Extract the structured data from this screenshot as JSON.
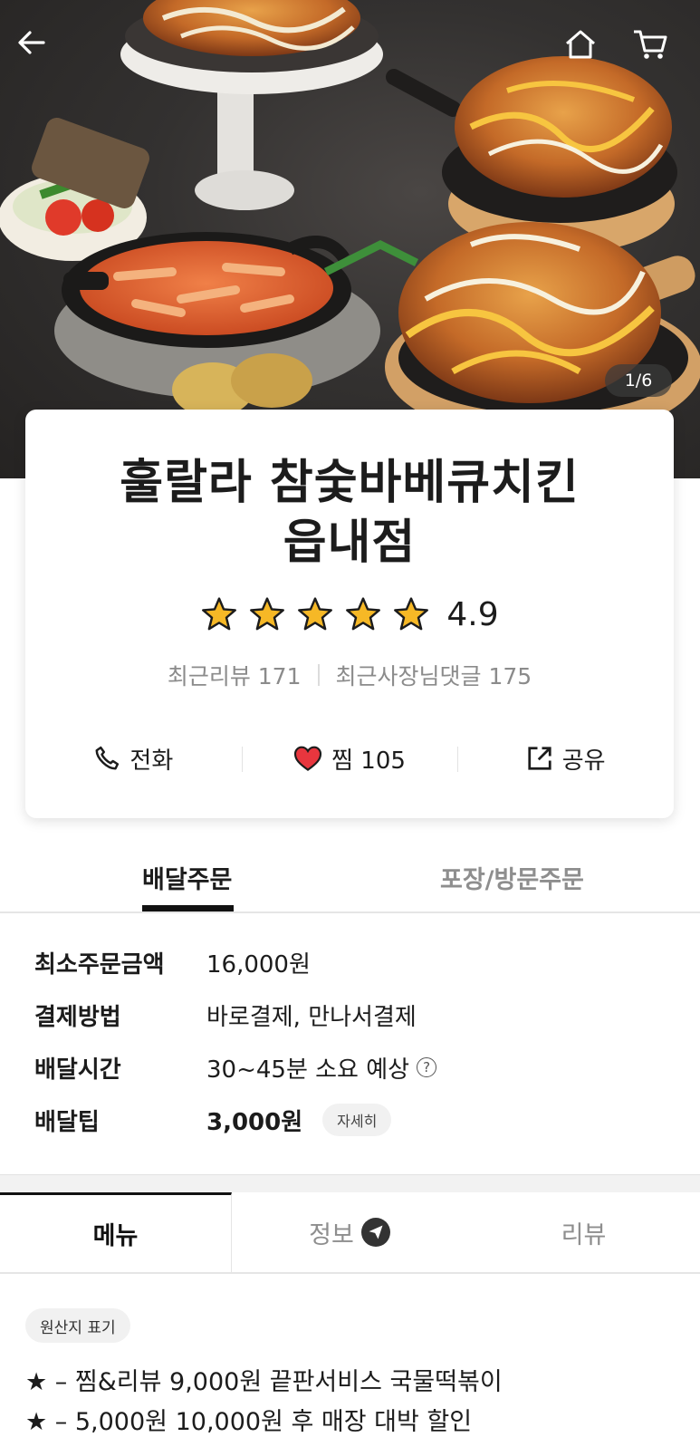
{
  "header": {
    "back_icon": "arrow-left-icon",
    "home_icon": "home-icon",
    "cart_icon": "cart-icon",
    "image_counter": "1/6"
  },
  "store": {
    "name_line1": "훌랄라 참숯바베큐치킨",
    "name_line2": "읍내점",
    "rating": "4.9",
    "star_count": 5,
    "recent_reviews_label": "최근리뷰 171",
    "recent_owner_replies_label": "최근사장님댓글 175",
    "actions": {
      "call_label": "전화",
      "like_label": "찜 105",
      "share_label": "공유"
    }
  },
  "order_tabs": {
    "delivery": "배달주문",
    "pickup": "포장/방문주문",
    "active": "delivery"
  },
  "delivery_info": {
    "min_order_label": "최소주문금액",
    "min_order_value": "16,000원",
    "payment_label": "결제방법",
    "payment_value": "바로결제, 만나서결제",
    "time_label": "배달시간",
    "time_value": "30~45분 소요 예상",
    "tip_label": "배달팁",
    "tip_value": "3,000원",
    "tip_detail": "자세히"
  },
  "menu_tabs": {
    "menu": "메뉴",
    "info": "정보",
    "review": "리뷰",
    "active": "menu"
  },
  "notice": {
    "origin_chip": "원산지 표기",
    "line1": "★ – 찜&리뷰 9,000원 끝판서비스 국물떡볶이",
    "line2": "★ – 5,000원 10,000원 후 매장 대박 할인"
  },
  "colors": {
    "heart": "#e8363e",
    "star": "#f6b826",
    "active_tab": "#111111",
    "inactive_tab": "#8e8e8e"
  }
}
